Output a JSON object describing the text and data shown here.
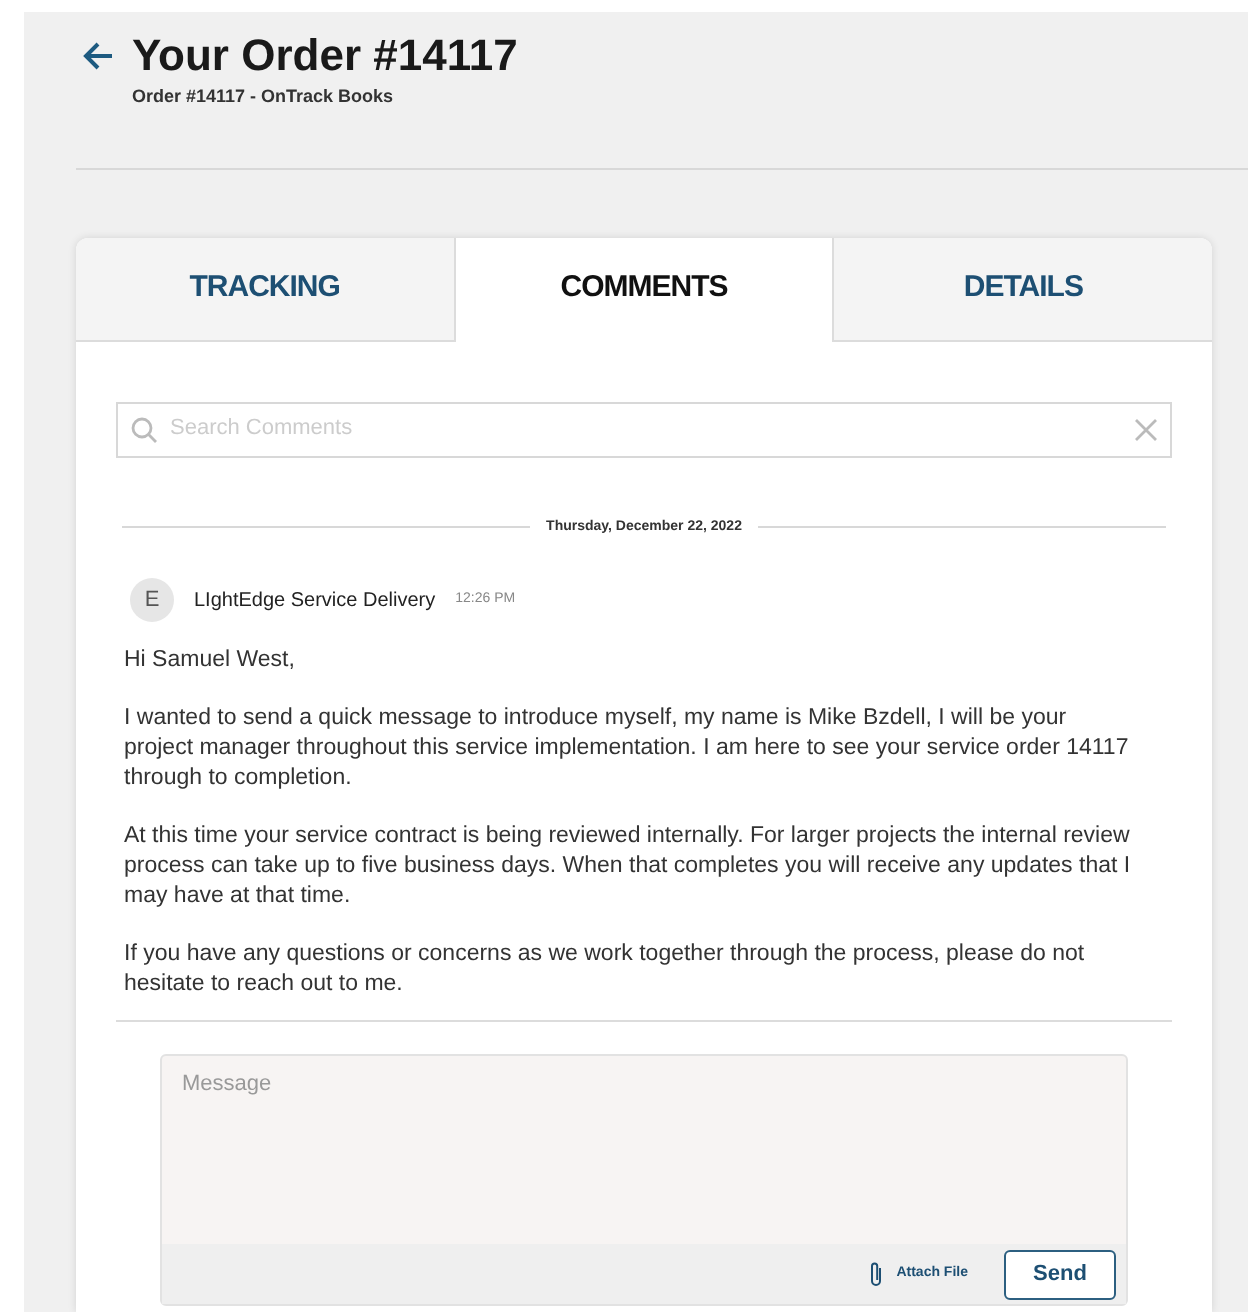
{
  "header": {
    "title": "Your Order #14117",
    "subtitle": "Order #14117 - OnTrack Books"
  },
  "tabs": [
    {
      "label": "TRACKING",
      "selected": false
    },
    {
      "label": "COMMENTS",
      "selected": true
    },
    {
      "label": "DETAILS",
      "selected": false
    }
  ],
  "search": {
    "placeholder": "Search Comments"
  },
  "date_divider": "Thursday, December 22, 2022",
  "comments": [
    {
      "avatar": "E",
      "author": "LIghtEdge Service Delivery",
      "time": "12:26 PM",
      "paragraphs": [
        "Hi Samuel West,",
        "I wanted to send a quick message to introduce myself, my name is Mike Bzdell, I will be your project manager throughout this service implementation. I am here to see your service order 14117 through to completion.",
        "At this time your service contract is being reviewed internally. For larger projects the internal review process can take up to five business days. When that completes you will receive any updates that I may have at that time.",
        "If you have any questions or concerns as we work together through the process, please do not hesitate to reach out to me."
      ]
    }
  ],
  "composer": {
    "placeholder": "Message",
    "attach": "Attach File",
    "send": "Send"
  }
}
